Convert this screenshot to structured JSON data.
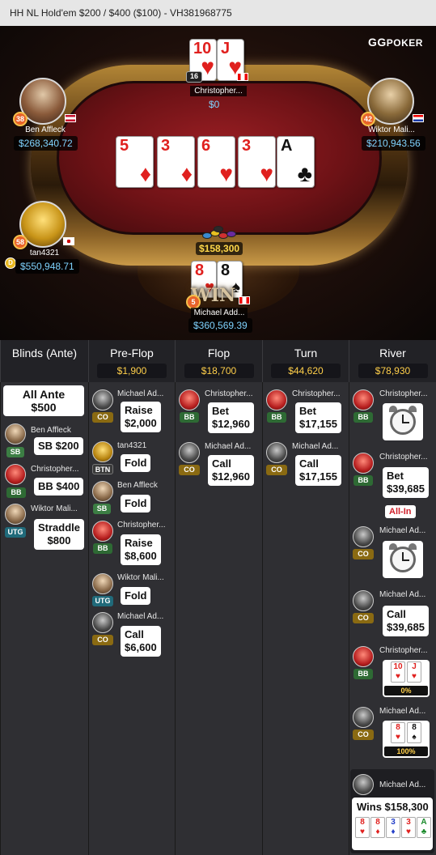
{
  "title": "HH NL Hold'em $200 / $400 ($100)   - VH381968775",
  "logo": {
    "gg": "GG",
    "poker": "POKER"
  },
  "players": {
    "top": {
      "name": "Christopher...",
      "stack": "$0",
      "level": "16"
    },
    "left_top": {
      "name": "Ben Affleck",
      "stack": "$268,340.72",
      "level": "38"
    },
    "right_top": {
      "name": "Wiktor Mali...",
      "stack": "$210,943.56",
      "level": "42"
    },
    "left_mid": {
      "name": "tan4321",
      "stack": "$550,948.71",
      "level": "58"
    },
    "bottom": {
      "name": "Michael Add...",
      "stack": "$360,569.39",
      "level": "5"
    }
  },
  "board": [
    {
      "rank": "5",
      "suit": "♦",
      "color": "#e0201e"
    },
    {
      "rank": "3",
      "suit": "♦",
      "color": "#e0201e"
    },
    {
      "rank": "6",
      "suit": "♥",
      "color": "#e0201e"
    },
    {
      "rank": "3",
      "suit": "♥",
      "color": "#e0201e"
    },
    {
      "rank": "A",
      "suit": "♣",
      "color": "#111111"
    }
  ],
  "top_hole": [
    {
      "rank": "10",
      "suit": "♥"
    },
    {
      "rank": "J",
      "suit": "♥"
    }
  ],
  "bottom_hole": [
    {
      "rank": "8",
      "suit": "♥"
    },
    {
      "rank": "8",
      "suit": "♠"
    }
  ],
  "pot": "$158,300",
  "win_label": "WIN",
  "columns": [
    {
      "title": "Blinds (Ante)",
      "pot": ""
    },
    {
      "title": "Pre-Flop",
      "pot": "$1,900"
    },
    {
      "title": "Flop",
      "pot": "$18,700"
    },
    {
      "title": "Turn",
      "pot": "$44,620"
    },
    {
      "title": "River",
      "pot": "$78,930"
    }
  ],
  "blinds": {
    "ante_line1": "All Ante",
    "ante_line2": "$500",
    "entries": [
      {
        "name": "Ben Affleck",
        "pos": "SB",
        "action": "SB  $200"
      },
      {
        "name": "Christopher...",
        "pos": "BB",
        "action": "BB  $400"
      },
      {
        "name": "Wiktor Mali...",
        "pos": "UTG",
        "action_line1": "Straddle",
        "action_line2": "$800"
      }
    ]
  },
  "preflop": [
    {
      "name": "Michael Ad...",
      "pos": "CO",
      "a1": "Raise",
      "a2": "$2,000"
    },
    {
      "name": "tan4321",
      "pos": "BTN",
      "a1": "Fold"
    },
    {
      "name": "Ben Affleck",
      "pos": "SB",
      "a1": "Fold"
    },
    {
      "name": "Christopher...",
      "pos": "BB",
      "a1": "Raise",
      "a2": "$8,600"
    },
    {
      "name": "Wiktor Mali...",
      "pos": "UTG",
      "a1": "Fold"
    },
    {
      "name": "Michael Ad...",
      "pos": "CO",
      "a1": "Call",
      "a2": "$6,600"
    }
  ],
  "flop": [
    {
      "name": "Christopher...",
      "pos": "BB",
      "a1": "Bet",
      "a2": "$12,960"
    },
    {
      "name": "Michael Ad...",
      "pos": "CO",
      "a1": "Call",
      "a2": "$12,960"
    }
  ],
  "turn": [
    {
      "name": "Christopher...",
      "pos": "BB",
      "a1": "Bet",
      "a2": "$17,155"
    },
    {
      "name": "Michael Ad...",
      "pos": "CO",
      "a1": "Call",
      "a2": "$17,155"
    }
  ],
  "river": {
    "e1": {
      "name": "Christopher...",
      "pos": "BB"
    },
    "e2": {
      "name": "Christopher...",
      "pos": "BB",
      "a1": "Bet",
      "a2": "$39,685",
      "allin": "All-In"
    },
    "e3": {
      "name": "Michael Ad...",
      "pos": "CO"
    },
    "e4": {
      "name": "Michael Ad...",
      "pos": "CO",
      "a1": "Call",
      "a2": "$39,685"
    },
    "e5": {
      "name": "Christopher...",
      "pos": "BB",
      "cards": [
        "10",
        "J"
      ],
      "equity": "0%"
    },
    "e6": {
      "name": "Michael Ad...",
      "pos": "CO",
      "cards": [
        "8",
        "8"
      ],
      "equity": "100%"
    },
    "winner": {
      "name": "Michael Ad...",
      "wins": "Wins $158,300",
      "cards": [
        "8",
        "8",
        "3",
        "3",
        "A"
      ]
    }
  }
}
